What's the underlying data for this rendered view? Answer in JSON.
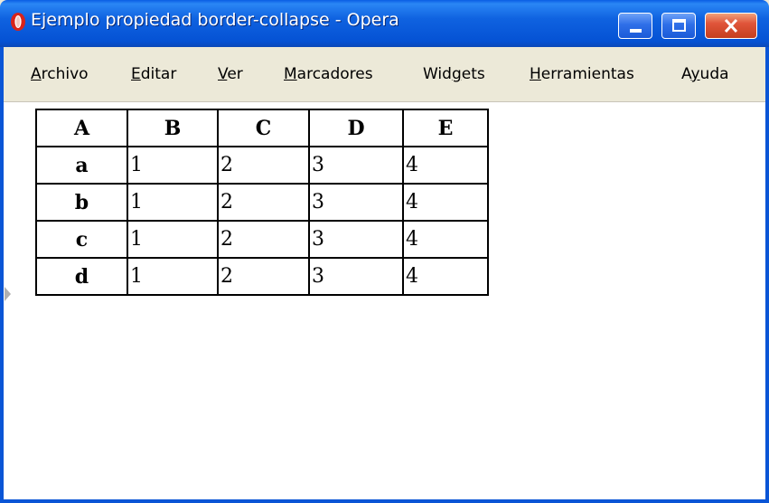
{
  "window": {
    "title": "Ejemplo propiedad border-collapse - Opera"
  },
  "menu": {
    "items": [
      {
        "label": "Archivo",
        "accel": "A",
        "rest": "rchivo"
      },
      {
        "label": "Editar",
        "accel": "E",
        "rest": "ditar"
      },
      {
        "label": "Ver",
        "accel": "V",
        "rest": "er"
      },
      {
        "label": "Marcadores",
        "accel": "M",
        "rest": "arcadores"
      },
      {
        "label": "Widgets",
        "pre": "Wid",
        "accel": "g",
        "rest": "ets"
      },
      {
        "label": "Herramientas",
        "accel": "H",
        "rest": "erramientas"
      },
      {
        "label": "Ayuda",
        "pre": "A",
        "accel": "y",
        "rest": "uda"
      }
    ]
  },
  "table": {
    "headers": [
      "A",
      "B",
      "C",
      "D",
      "E"
    ],
    "rows": [
      [
        "a",
        "1",
        "2",
        "3",
        "4"
      ],
      [
        "b",
        "1",
        "2",
        "3",
        "4"
      ],
      [
        "c",
        "1",
        "2",
        "3",
        "4"
      ],
      [
        "d",
        "1",
        "2",
        "3",
        "4"
      ]
    ]
  },
  "colors": {
    "titlebar": "#0552d4",
    "close_button": "#e0553a",
    "menubar": "#ece9d8",
    "content": "#ffffff",
    "table_border": "#000000"
  },
  "icons": {
    "app": "opera-logo-icon",
    "minimize": "minimize-icon",
    "maximize": "maximize-icon",
    "close": "close-icon"
  }
}
